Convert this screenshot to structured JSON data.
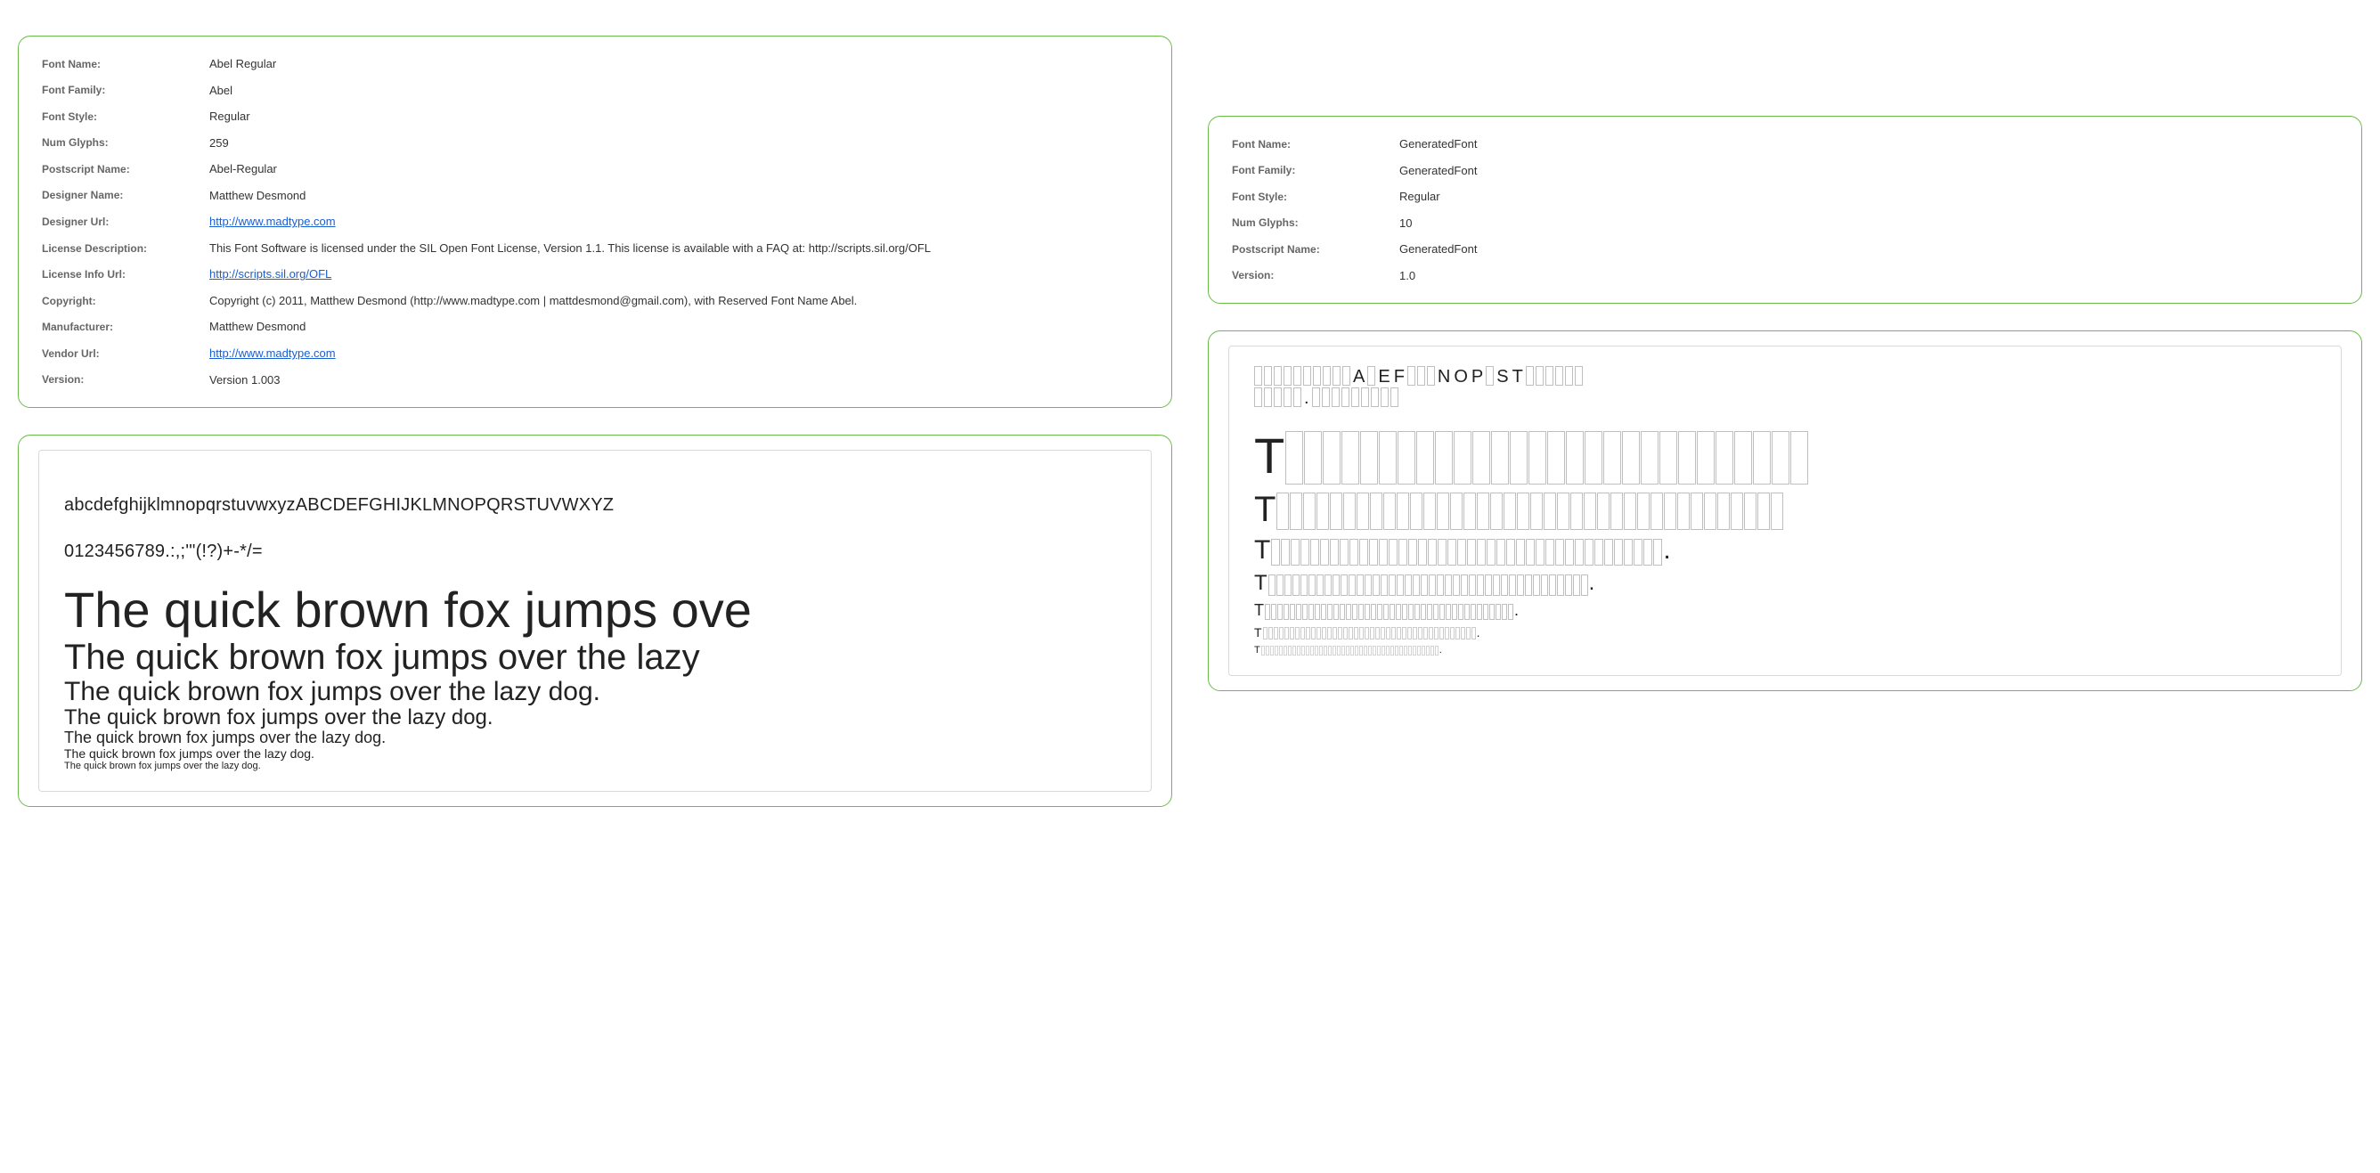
{
  "left": {
    "meta": {
      "rows": [
        {
          "label": "Font Name:",
          "value": "Abel Regular"
        },
        {
          "label": "Font Family:",
          "value": "Abel"
        },
        {
          "label": "Font Style:",
          "value": "Regular"
        },
        {
          "label": "Num Glyphs:",
          "value": "259"
        },
        {
          "label": "Postscript Name:",
          "value": "Abel-Regular"
        },
        {
          "label": "Designer Name:",
          "value": "Matthew Desmond"
        },
        {
          "label": "Designer Url:",
          "value": "http://www.madtype.com",
          "is_link": true
        },
        {
          "label": "License Description:",
          "value": "This Font Software is licensed under the SIL Open Font License, Version 1.1. This license is available with a FAQ at: http://scripts.sil.org/OFL"
        },
        {
          "label": "License Info Url:",
          "value": "http://scripts.sil.org/OFL",
          "is_link": true
        },
        {
          "label": "Copyright:",
          "value": "Copyright (c) 2011, Matthew Desmond (http://www.madtype.com | mattdesmond@gmail.com), with Reserved Font Name Abel."
        },
        {
          "label": "Manufacturer:",
          "value": "Matthew Desmond"
        },
        {
          "label": "Vendor Url:",
          "value": "http://www.madtype.com",
          "is_link": true
        },
        {
          "label": "Version:",
          "value": "Version 1.003"
        }
      ]
    },
    "sample": {
      "charset_lines": [
        "abcdefghijklmnopqrstuvwxyzABCDEFGHIJKLMNOPQRSTUVWXYZ",
        "0123456789.:,;'\"(!?)+-*/="
      ],
      "waterfall": [
        "The quick brown fox jumps ove",
        "The quick brown fox jumps over the lazy",
        "The quick brown fox jumps over the lazy dog.",
        "The quick brown fox jumps over the lazy dog.",
        "The quick brown fox jumps over the lazy dog.",
        "The quick brown fox jumps over the lazy dog.",
        "The quick brown fox jumps over the lazy dog."
      ]
    }
  },
  "right": {
    "meta": {
      "rows": [
        {
          "label": "Font Name:",
          "value": "GeneratedFont"
        },
        {
          "label": "Font Family:",
          "value": "GeneratedFont"
        },
        {
          "label": "Font Style:",
          "value": "Regular"
        },
        {
          "label": "Num Glyphs:",
          "value": "10"
        },
        {
          "label": "Postscript Name:",
          "value": "GeneratedFont"
        },
        {
          "label": "Version:",
          "value": "1.0"
        }
      ]
    },
    "sample": {
      "charset_pattern_line1": "##########A#EF###NOP#ST######",
      "charset_pattern_line2": "#####.#########",
      "present_glyphs": [
        "A",
        "E",
        "F",
        "N",
        "O",
        "P",
        "S",
        "T",
        "."
      ],
      "waterfall_text": "The quick brown fox jumps over the lazy dog.",
      "waterfall_box_counts": [
        28,
        38,
        40,
        40,
        40,
        40,
        40
      ],
      "waterfall_trailing_period_from_index": 2
    }
  }
}
